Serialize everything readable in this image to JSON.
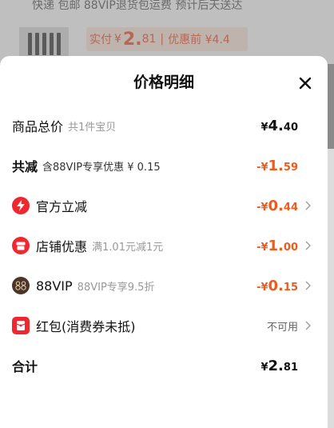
{
  "background": {
    "top_text": "快递 包邮 88VIP退货包运费 预计后天送达",
    "actual_label": "实付",
    "actual_currency": "¥",
    "actual_int": "2.",
    "actual_dec": "81",
    "separator": "|",
    "before_discount": "优惠前 ¥4.4"
  },
  "sheet": {
    "title": "价格明细",
    "rows": [
      {
        "label": "商品总价",
        "sub": "共1件宝贝",
        "currency": "¥",
        "int": "4.",
        "dec": "40"
      },
      {
        "label": "共减",
        "sub": "含88VIP专享优惠 ¥ 0.15",
        "currency": "-¥",
        "int": "1.",
        "dec": "59"
      },
      {
        "label": "官方立减",
        "icon": "lightning-icon",
        "currency": "-¥",
        "int": "0.",
        "dec": "44"
      },
      {
        "label": "店铺优惠",
        "icon": "shop-icon",
        "sub": "满1.01元减1元",
        "currency": "-¥",
        "int": "1.",
        "dec": "00"
      },
      {
        "label": "88VIP",
        "icon": "vip-88-icon",
        "sub": "88VIP专享9.5折",
        "currency": "-¥",
        "int": "0.",
        "dec": "15"
      },
      {
        "label": "红包(消费券未抵)",
        "icon": "red-packet-icon",
        "status": "不可用"
      },
      {
        "label": "合计",
        "currency": "¥",
        "int": "2.",
        "dec": "81"
      }
    ]
  },
  "colors": {
    "accent_orange": "#f05a1a",
    "icon_red": "#f0272f",
    "vip_dark": "#4a3528"
  }
}
